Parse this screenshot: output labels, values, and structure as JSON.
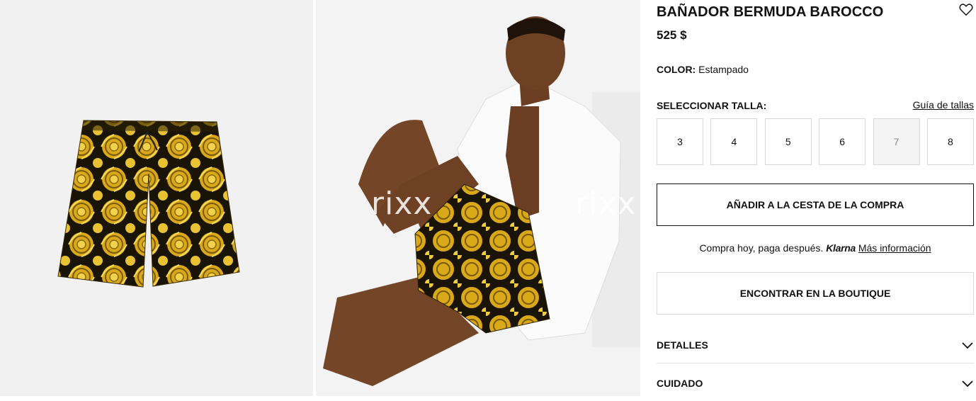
{
  "product": {
    "title": "BAÑADOR BERMUDA BAROCCO",
    "price": "525 $",
    "color_label": "COLOR:",
    "color_value": "Estampado"
  },
  "gallery": {
    "watermark": "rixx"
  },
  "sizes": {
    "label": "SELECCIONAR TALLA:",
    "guide": "Guía de tallas",
    "options": [
      "3",
      "4",
      "5",
      "6",
      "7",
      "8"
    ],
    "unavailable": [
      "7"
    ]
  },
  "actions": {
    "add_to_cart": "AÑADIR A LA CESTA DE LA COMPRA",
    "klarna_text": "Compra hoy, paga después.",
    "klarna_brand": "Klarna",
    "klarna_more": "Más información",
    "find_boutique": "ENCONTRAR EN LA BOUTIQUE"
  },
  "accordions": {
    "details": "DETALLES",
    "care": "CUIDADO"
  },
  "colors": {
    "pattern_gold": "#e3b81f",
    "pattern_black": "#1a1406"
  },
  "icons": {
    "wishlist": "heart-icon",
    "expand": "chevron-down-icon"
  }
}
